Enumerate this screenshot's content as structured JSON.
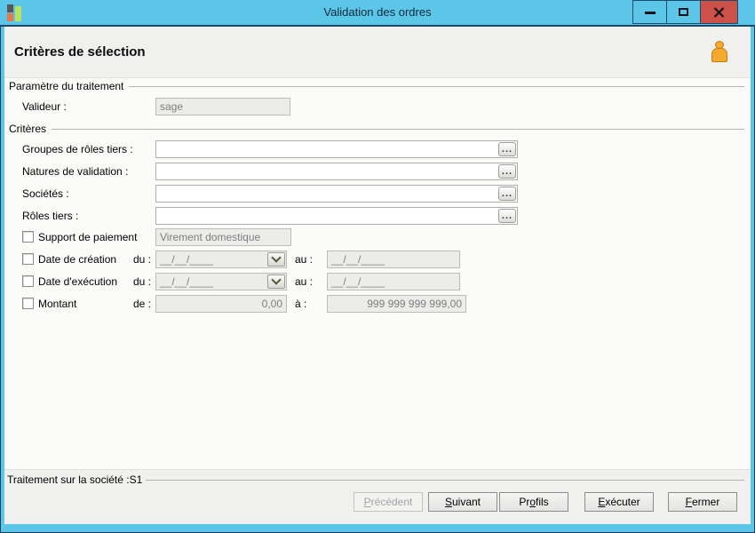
{
  "window": {
    "title": "Validation des ordres",
    "controls": {
      "minimize": "minimize",
      "maximize": "maximize",
      "close": "close"
    }
  },
  "header": {
    "title": "Critères de sélection",
    "icon": "person"
  },
  "parametre": {
    "group_label": "Paramètre du traitement",
    "valideur": {
      "label": "Valideur :",
      "value": "sage",
      "disabled": true
    }
  },
  "criteres": {
    "group_label": "Critères",
    "ellipsis_glyph": "...",
    "lookups": [
      {
        "label": "Groupes de rôles tiers :",
        "value": ""
      },
      {
        "label": "Natures de validation :",
        "value": ""
      },
      {
        "label": "Sociétés :",
        "value": ""
      },
      {
        "label": "Rôles tiers :",
        "value": ""
      }
    ],
    "support": {
      "label": "Support de paiement",
      "checked": false,
      "value": "Virement domestique"
    },
    "dates": [
      {
        "label": "Date de création",
        "checked": false,
        "from_label": "du :",
        "from_value": "__/__/____",
        "to_label": "au :",
        "to_value": "__/__/____"
      },
      {
        "label": "Date d'exécution",
        "checked": false,
        "from_label": "du :",
        "from_value": "__/__/____",
        "to_label": "au :",
        "to_value": "__/__/____"
      }
    ],
    "montant": {
      "label": "Montant",
      "checked": false,
      "from_label": "de :",
      "from_value": "0,00",
      "to_label": "à :",
      "to_value": "999 999 999 999,00"
    }
  },
  "footer": {
    "status": "Traitement sur la société :S1",
    "buttons": [
      {
        "label": "Précédent",
        "pre": "",
        "key": "P",
        "post": "récédent",
        "disabled": true
      },
      {
        "label": "Suivant",
        "pre": "",
        "key": "S",
        "post": "uivant",
        "disabled": false
      },
      {
        "label": "Profils",
        "pre": "Pr",
        "key": "o",
        "post": "fils",
        "disabled": false
      },
      {
        "label": "Exécuter",
        "pre": "",
        "key": "E",
        "post": "xécuter",
        "disabled": false
      },
      {
        "label": "Fermer",
        "pre": "",
        "key": "F",
        "post": "ermer",
        "disabled": false
      }
    ]
  },
  "colors": {
    "titlebar": "#5bc6e8",
    "frame_dark": "#1d4a6b",
    "close_red": "#cb5149",
    "band_gray": "#f0f0ee",
    "content_bg": "#fbfbfa",
    "disabled_field_bg": "#ececea",
    "person_orange": "#f6a92c",
    "logo_green": "#b9e25f",
    "logo_orange": "#e7764e"
  }
}
